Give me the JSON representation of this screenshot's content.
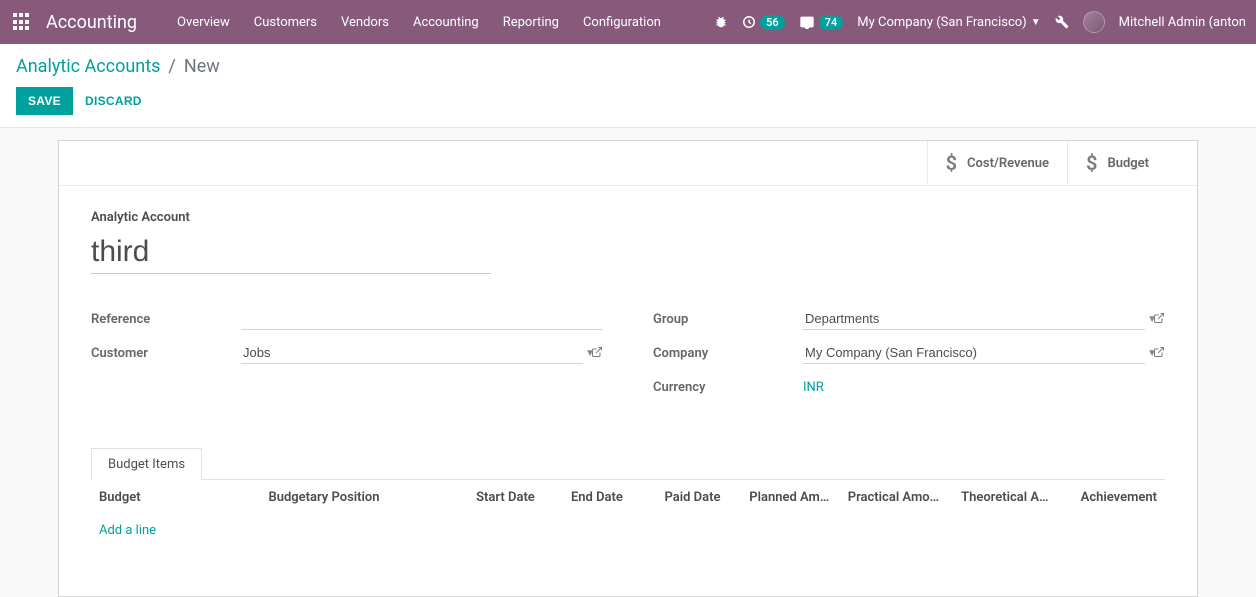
{
  "navbar": {
    "app_name": "Accounting",
    "menu": [
      "Overview",
      "Customers",
      "Vendors",
      "Accounting",
      "Reporting",
      "Configuration"
    ],
    "activities_count": "56",
    "messages_count": "74",
    "company": "My Company (San Francisco)",
    "user": "Mitchell Admin (anton"
  },
  "breadcrumb": {
    "parent": "Analytic Accounts",
    "current": "New"
  },
  "buttons": {
    "save": "Save",
    "discard": "Discard"
  },
  "stat_buttons": {
    "cost_revenue": "Cost/Revenue",
    "budget": "Budget"
  },
  "form": {
    "title_label": "Analytic Account",
    "title_value": "third",
    "left": {
      "reference_label": "Reference",
      "reference_value": "",
      "customer_label": "Customer",
      "customer_value": "Jobs"
    },
    "right": {
      "group_label": "Group",
      "group_value": "Departments",
      "company_label": "Company",
      "company_value": "My Company (San Francisco)",
      "currency_label": "Currency",
      "currency_value": "INR"
    }
  },
  "tabs": {
    "budget_items": "Budget Items"
  },
  "table": {
    "headers": {
      "budget": "Budget",
      "budgetary_position": "Budgetary Position",
      "start_date": "Start Date",
      "end_date": "End Date",
      "paid_date": "Paid Date",
      "planned_amount": "Planned Am…",
      "practical_amount": "Practical Amo…",
      "theoretical_amount": "Theoretical A…",
      "achievement": "Achievement"
    },
    "add_line": "Add a line"
  }
}
